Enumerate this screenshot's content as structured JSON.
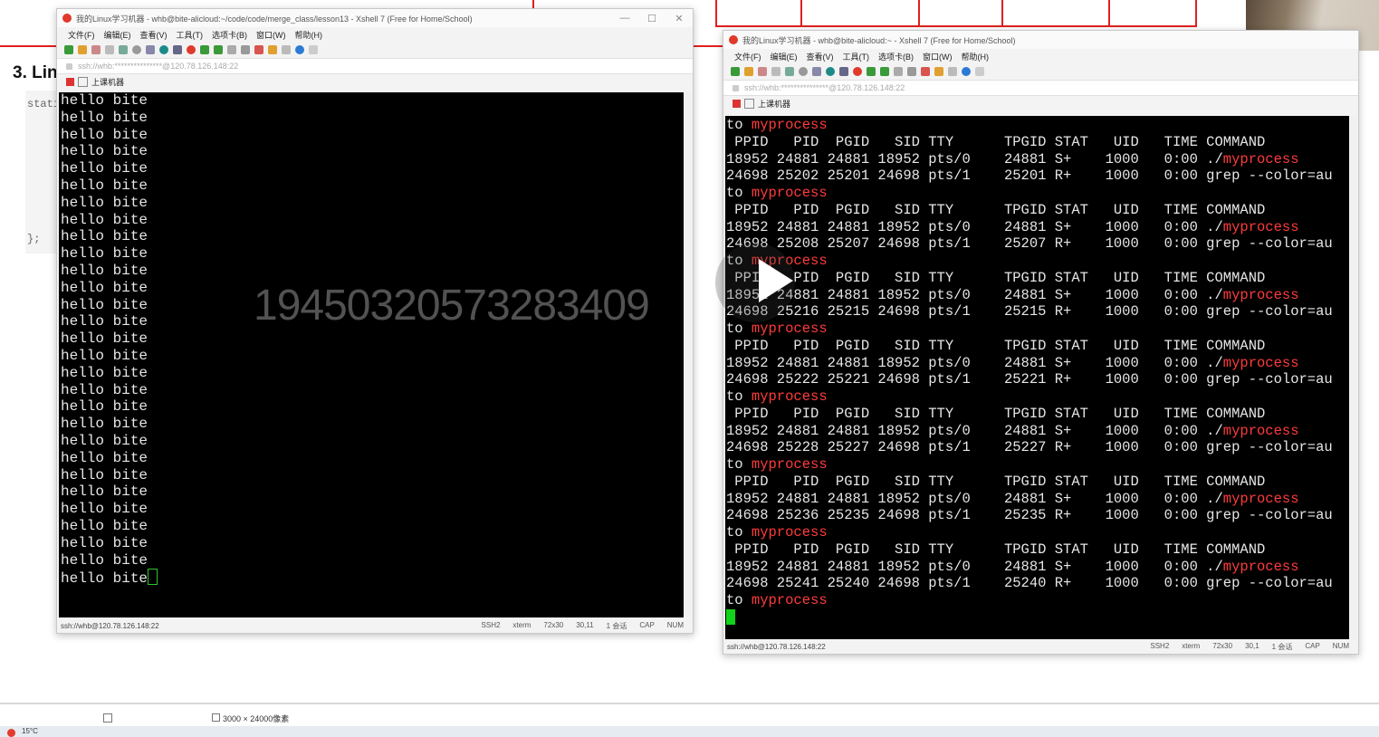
{
  "background": {
    "heading": "3. Lin",
    "code_lines": [
      "stati",
      "};"
    ]
  },
  "left_window": {
    "title": "我的Linux学习机器 - whb@bite-alicloud:~/code/code/merge_class/lesson13 - Xshell 7 (Free for Home/School)",
    "menu": [
      "文件(F)",
      "编辑(E)",
      "查看(V)",
      "工具(T)",
      "选项卡(B)",
      "窗口(W)",
      "帮助(H)"
    ],
    "address": "ssh://whb:***************@120.78.126.148:22",
    "tab_label": "上课机器",
    "terminal_lines": [
      "hello bite",
      "hello bite",
      "hello bite",
      "hello bite",
      "hello bite",
      "hello bite",
      "hello bite",
      "hello bite",
      "hello bite",
      "hello bite",
      "hello bite",
      "hello bite",
      "hello bite",
      "hello bite",
      "hello bite",
      "hello bite",
      "hello bite",
      "hello bite",
      "hello bite",
      "hello bite",
      "hello bite",
      "hello bite",
      "hello bite",
      "hello bite",
      "hello bite",
      "hello bite",
      "hello bite",
      "hello bite",
      "hello bite"
    ],
    "status": {
      "conn": "ssh://whb@120.78.126.148:22",
      "proto": "SSH2",
      "term": "xterm",
      "size": "72x30",
      "pos": "30,11",
      "sessions": "1 会话",
      "caps": "CAP",
      "num": "NUM"
    }
  },
  "right_window": {
    "title": "我的Linux学习机器 - whb@bite-alicloud:~ - Xshell 7 (Free for Home/School)",
    "menu": [
      "文件(F)",
      "编辑(E)",
      "查看(V)",
      "工具(T)",
      "选项卡(B)",
      "窗口(W)",
      "帮助(H)"
    ],
    "address": "ssh://whb:***************@120.78.126.148:22",
    "tab_label": "上课机器",
    "prefix": "to ",
    "highlight": "myprocess",
    "header": " PPID   PID  PGID   SID TTY      TPGID STAT   UID   TIME COMMAND",
    "blocks": [
      {
        "row1": "18952 24881 24881 18952 pts/0    24881 S+    1000   0:00 ./",
        "row2": "24698 25202 25201 24698 pts/1    25201 R+    1000   0:00 grep --color=au"
      },
      {
        "row1": "18952 24881 24881 18952 pts/0    24881 S+    1000   0:00 ./",
        "row2": "24698 25208 25207 24698 pts/1    25207 R+    1000   0:00 grep --color=au"
      },
      {
        "row1": "18952 24881 24881 18952 pts/0    24881 S+    1000   0:00 ./",
        "row2": "24698 25216 25215 24698 pts/1    25215 R+    1000   0:00 grep --color=au"
      },
      {
        "row1": "18952 24881 24881 18952 pts/0    24881 S+    1000   0:00 ./",
        "row2": "24698 25222 25221 24698 pts/1    25221 R+    1000   0:00 grep --color=au"
      },
      {
        "row1": "18952 24881 24881 18952 pts/0    24881 S+    1000   0:00 ./",
        "row2": "24698 25228 25227 24698 pts/1    25227 R+    1000   0:00 grep --color=au"
      },
      {
        "row1": "18952 24881 24881 18952 pts/0    24881 S+    1000   0:00 ./",
        "row2": "24698 25236 25235 24698 pts/1    25235 R+    1000   0:00 grep --color=au"
      },
      {
        "row1": "18952 24881 24881 18952 pts/0    24881 S+    1000   0:00 ./",
        "row2": "24698 25241 25240 24698 pts/1    25240 R+    1000   0:00 grep --color=au"
      }
    ],
    "status": {
      "conn": "ssh://whb@120.78.126.148:22",
      "proto": "SSH2",
      "term": "xterm",
      "size": "72x30",
      "pos": "30,1",
      "sessions": "1 会话",
      "caps": "CAP",
      "num": "NUM"
    }
  },
  "overlay": {
    "watermark": "19450320573283409",
    "play_icon": "play-icon"
  },
  "bottom": {
    "image_size": "3000 × 24000像素",
    "weather": "15°C"
  },
  "colors": {
    "highlight": "#ff3b3b",
    "terminal_bg": "#000000",
    "cursor": "#12d21a"
  }
}
